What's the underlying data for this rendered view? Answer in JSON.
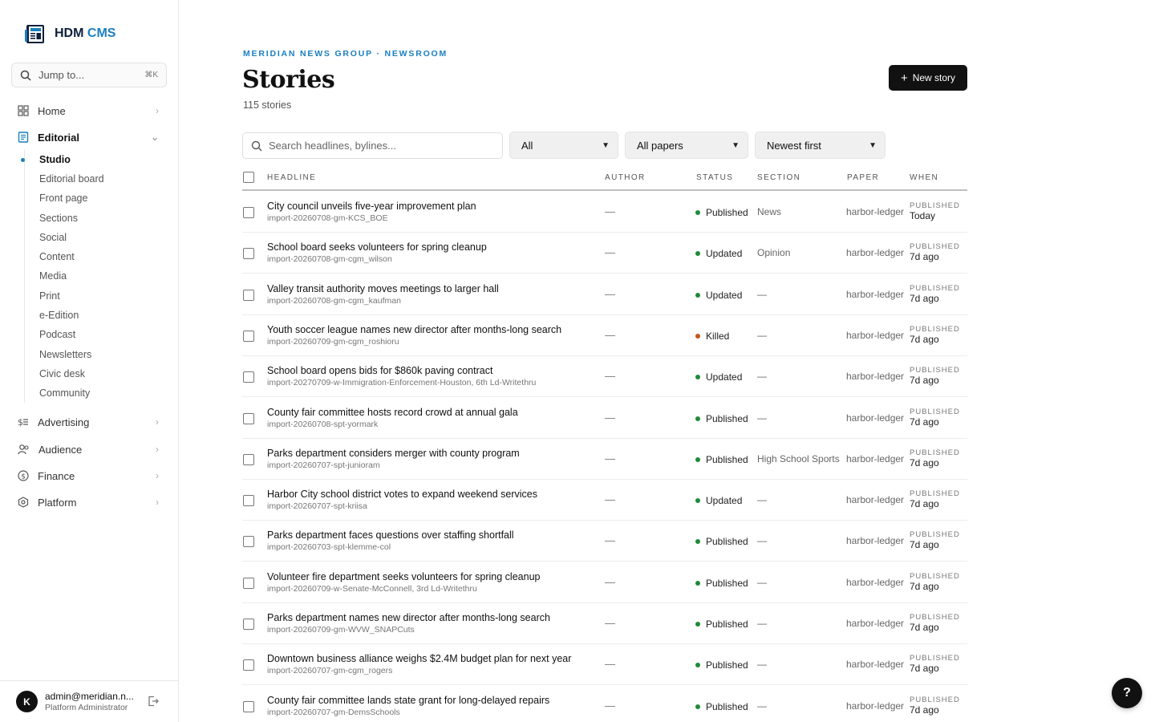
{
  "brand": {
    "name": "HDM",
    "suffix": "CMS"
  },
  "jump": {
    "placeholder": "Jump to...",
    "shortcut": "⌘K"
  },
  "nav": {
    "home": "Home",
    "editorial": "Editorial",
    "advertising": "Advertising",
    "audience": "Audience",
    "finance": "Finance",
    "platform": "Platform"
  },
  "subnav": [
    "Studio",
    "Editorial board",
    "Front page",
    "Sections",
    "Social",
    "Content",
    "Media",
    "Print",
    "e-Edition",
    "Podcast",
    "Newsletters",
    "Civic desk",
    "Community"
  ],
  "user": {
    "initial": "K",
    "email": "admin@meridian.n...",
    "role": "Platform Administrator"
  },
  "header": {
    "eyebrow": "MERIDIAN NEWS GROUP · NEWSROOM",
    "title": "Stories",
    "count": "115 stories",
    "new_story": "New story"
  },
  "filters": {
    "search_placeholder": "Search headlines, bylines...",
    "status": "All",
    "paper": "All papers",
    "sort": "Newest first"
  },
  "columns": {
    "headline": "HEADLINE",
    "author": "AUTHOR",
    "status": "STATUS",
    "section": "SECTION",
    "paper": "PAPER",
    "when": "WHEN"
  },
  "colors": {
    "published": "#1f8a3a",
    "updated": "#1f8a3a",
    "killed": "#c2571a",
    "accent": "#1a7fc1"
  },
  "rows": [
    {
      "headline": "City council unveils five-year improvement plan",
      "slug": "import-20260708-gm-KCS_BOE",
      "author": "—",
      "status": "Published",
      "section": "News",
      "paper": "harbor-ledger",
      "when_label": "PUBLISHED",
      "when": "Today"
    },
    {
      "headline": "School board seeks volunteers for spring cleanup",
      "slug": "import-20260708-gm-cgm_wilson",
      "author": "—",
      "status": "Updated",
      "section": "Opinion",
      "paper": "harbor-ledger",
      "when_label": "PUBLISHED",
      "when": "7d ago"
    },
    {
      "headline": "Valley transit authority moves meetings to larger hall",
      "slug": "import-20260708-gm-cgm_kaufman",
      "author": "—",
      "status": "Updated",
      "section": "—",
      "paper": "harbor-ledger",
      "when_label": "PUBLISHED",
      "when": "7d ago"
    },
    {
      "headline": "Youth soccer league names new director after months-long search",
      "slug": "import-20260709-gm-cgm_roshioru",
      "author": "—",
      "status": "Killed",
      "section": "—",
      "paper": "harbor-ledger",
      "when_label": "PUBLISHED",
      "when": "7d ago"
    },
    {
      "headline": "School board opens bids for $860k paving contract",
      "slug": "import-20270709-w-Immigration-Enforcement-Houston, 6th Ld-Writethru",
      "author": "—",
      "status": "Updated",
      "section": "—",
      "paper": "harbor-ledger",
      "when_label": "PUBLISHED",
      "when": "7d ago"
    },
    {
      "headline": "County fair committee hosts record crowd at annual gala",
      "slug": "import-20260708-spt-yormark",
      "author": "—",
      "status": "Published",
      "section": "—",
      "paper": "harbor-ledger",
      "when_label": "PUBLISHED",
      "when": "7d ago"
    },
    {
      "headline": "Parks department considers merger with county program",
      "slug": "import-20260707-spt-junioram",
      "author": "—",
      "status": "Published",
      "section": "High School Sports",
      "paper": "harbor-ledger",
      "when_label": "PUBLISHED",
      "when": "7d ago"
    },
    {
      "headline": "Harbor City school district votes to expand weekend services",
      "slug": "import-20260707-spt-kriisa",
      "author": "—",
      "status": "Updated",
      "section": "—",
      "paper": "harbor-ledger",
      "when_label": "PUBLISHED",
      "when": "7d ago"
    },
    {
      "headline": "Parks department faces questions over staffing shortfall",
      "slug": "import-20260703-spt-klemme-col",
      "author": "—",
      "status": "Published",
      "section": "—",
      "paper": "harbor-ledger",
      "when_label": "PUBLISHED",
      "when": "7d ago"
    },
    {
      "headline": "Volunteer fire department seeks volunteers for spring cleanup",
      "slug": "import-20260709-w-Senate-McConnell, 3rd Ld-Writethru",
      "author": "—",
      "status": "Published",
      "section": "—",
      "paper": "harbor-ledger",
      "when_label": "PUBLISHED",
      "when": "7d ago"
    },
    {
      "headline": "Parks department names new director after months-long search",
      "slug": "import-20260709-gm-WVW_SNAPCuts",
      "author": "—",
      "status": "Published",
      "section": "—",
      "paper": "harbor-ledger",
      "when_label": "PUBLISHED",
      "when": "7d ago"
    },
    {
      "headline": "Downtown business alliance weighs $2.4M budget plan for next year",
      "slug": "import-20260707-gm-cgm_rogers",
      "author": "—",
      "status": "Published",
      "section": "—",
      "paper": "harbor-ledger",
      "when_label": "PUBLISHED",
      "when": "7d ago"
    },
    {
      "headline": "County fair committee lands state grant for long-delayed repairs",
      "slug": "import-20260707-gm-DemsSchools",
      "author": "—",
      "status": "Published",
      "section": "—",
      "paper": "harbor-ledger",
      "when_label": "PUBLISHED",
      "when": "7d ago"
    }
  ],
  "help": "?"
}
